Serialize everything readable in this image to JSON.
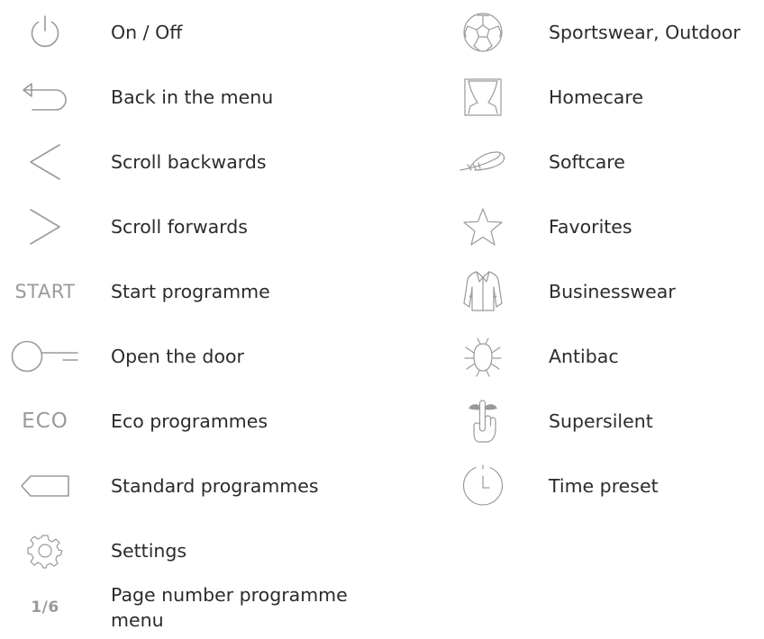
{
  "left_items": [
    {
      "label": "On / Off",
      "icon": "power-icon"
    },
    {
      "label": "Back in the menu",
      "icon": "back-arrow-icon"
    },
    {
      "label": "Scroll backwards",
      "icon": "chevron-left-icon"
    },
    {
      "label": "Scroll forwards",
      "icon": "chevron-right-icon"
    },
    {
      "label": "Start programme",
      "icon": "start-text-icon",
      "icon_text": "START"
    },
    {
      "label": "Open the door",
      "icon": "key-icon"
    },
    {
      "label": "Eco programmes",
      "icon": "eco-text-icon",
      "icon_text": "ECO"
    },
    {
      "label": "Standard programmes",
      "icon": "tag-icon"
    },
    {
      "label": "Settings",
      "icon": "gear-icon"
    },
    {
      "label": "Page number programme menu",
      "icon": "page-number-icon",
      "icon_text": "1/6"
    }
  ],
  "right_items": [
    {
      "label": "Sportswear, Outdoor",
      "icon": "football-icon"
    },
    {
      "label": "Homecare",
      "icon": "curtain-window-icon"
    },
    {
      "label": "Softcare",
      "icon": "feather-icon"
    },
    {
      "label": "Favorites",
      "icon": "star-icon"
    },
    {
      "label": "Businesswear",
      "icon": "shirt-icon"
    },
    {
      "label": "Antibac",
      "icon": "bug-icon"
    },
    {
      "label": "Supersilent",
      "icon": "silence-finger-icon"
    },
    {
      "label": "Time preset",
      "icon": "timer-clock-icon"
    }
  ],
  "colors": {
    "icon": "#9a9a9a",
    "text": "#2b2b2b",
    "background": "#ffffff"
  }
}
